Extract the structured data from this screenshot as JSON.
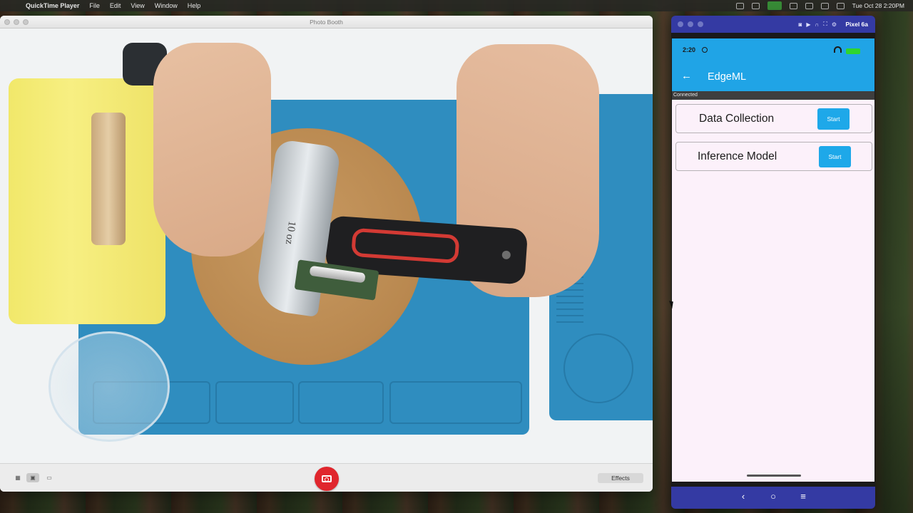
{
  "menubar": {
    "app_name": "QuickTime Player",
    "menus": [
      "File",
      "Edit",
      "View",
      "Window",
      "Help"
    ],
    "clock": "Tue Oct 28  2:20PM"
  },
  "photobooth": {
    "title": "Photo Booth",
    "hammer_marking": "10 oz",
    "effects_label": "Effects"
  },
  "emulator": {
    "device_name": "Pixel 6a",
    "status_time": "2:20",
    "app_title": "EdgeML",
    "connection_status": "Connected",
    "cards": [
      {
        "label": "Data Collection",
        "button": "Start"
      },
      {
        "label": "Inference Model",
        "button": "Start"
      }
    ],
    "nav": {
      "back": "‹",
      "home": "○",
      "menu": "≡"
    }
  },
  "colors": {
    "accent": "#20a4e6",
    "emulator_chrome": "#343aa3",
    "shutter": "#e0262d"
  }
}
